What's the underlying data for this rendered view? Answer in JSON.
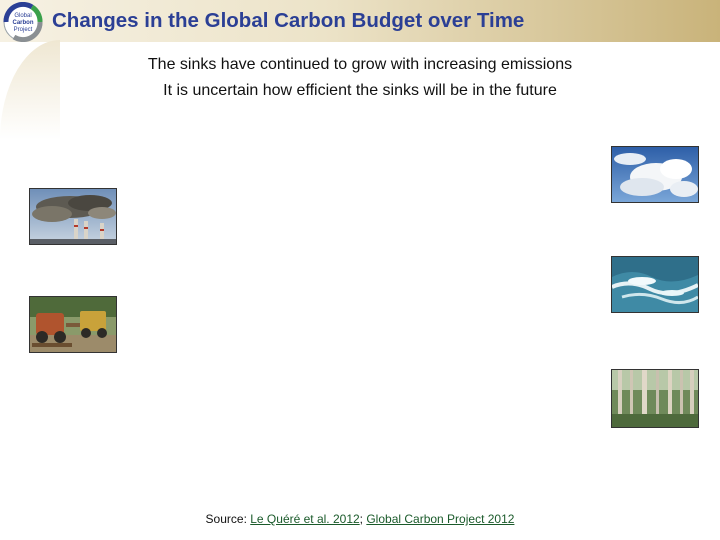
{
  "header": {
    "title": "Changes in the Global Carbon Budget over Time",
    "logo_text": [
      "Global",
      "Carbon",
      "Project"
    ]
  },
  "subtitle": {
    "line1": "The sinks have continued to grow with increasing emissions",
    "line2": "It is uncertain how efficient the sinks will be in the future"
  },
  "images": {
    "left": [
      "smokestacks-photo",
      "deforestation-photo"
    ],
    "right": [
      "clouds-photo",
      "ocean-photo",
      "forest-photo"
    ]
  },
  "source": {
    "prefix": "Source: ",
    "link1": "Le Quéré et al. 2012",
    "separator": "; ",
    "link2": "Global Carbon Project 2012"
  },
  "colors": {
    "title": "#2b3f95",
    "header_band_light": "#f6f1e3",
    "header_band_dark": "#c9b37a",
    "link": "#1a5a2a"
  }
}
